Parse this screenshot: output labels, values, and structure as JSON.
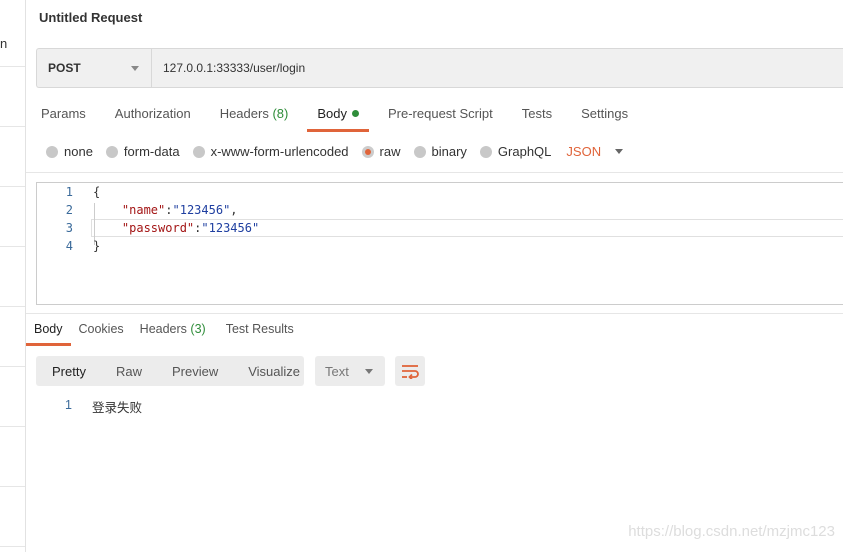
{
  "sidebar": {
    "cut_text": "n"
  },
  "request": {
    "title": "Untitled Request",
    "method": "POST",
    "url": "127.0.0.1:33333/user/login"
  },
  "req_tabs": [
    {
      "label": "Params"
    },
    {
      "label": "Authorization"
    },
    {
      "label": "Headers",
      "count": "(8)"
    },
    {
      "label": "Body",
      "active": true
    },
    {
      "label": "Pre-request Script"
    },
    {
      "label": "Tests"
    },
    {
      "label": "Settings"
    }
  ],
  "body_modes": {
    "options": [
      "none",
      "form-data",
      "x-www-form-urlencoded",
      "raw",
      "binary",
      "GraphQL"
    ],
    "selected": "raw",
    "format": "JSON"
  },
  "editor": {
    "lines": [
      {
        "n": "1",
        "text": "{"
      },
      {
        "n": "2",
        "key": "\"name\"",
        "value": "\"123456\"",
        "trail": ","
      },
      {
        "n": "3",
        "key": "\"password\"",
        "value": "\"123456\"",
        "trail": ""
      },
      {
        "n": "4",
        "text": "}"
      }
    ]
  },
  "resp_tabs": [
    {
      "label": "Body",
      "active": true
    },
    {
      "label": "Cookies"
    },
    {
      "label": "Headers",
      "count": "(3)"
    },
    {
      "label": "Test Results"
    }
  ],
  "view": {
    "modes": [
      "Pretty",
      "Raw",
      "Preview",
      "Visualize"
    ],
    "selected": "Pretty",
    "type": "Text"
  },
  "response": {
    "line": "1",
    "text": "登录失败"
  },
  "watermark": "https://blog.csdn.net/mzjmc123",
  "colors": {
    "accent": "#e0643a",
    "green": "#2f8d3a"
  }
}
